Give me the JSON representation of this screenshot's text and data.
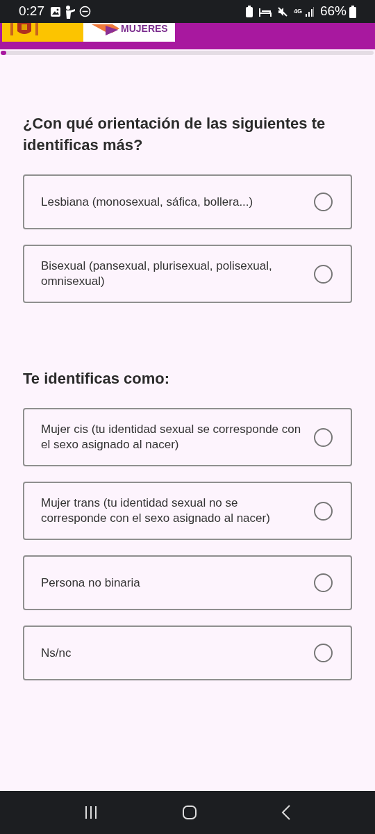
{
  "status_bar": {
    "time": "0:27",
    "network": "4G",
    "battery": "66%"
  },
  "header": {
    "logo_text": "MUJERES"
  },
  "progress": {
    "level": 0.015
  },
  "questions": [
    {
      "title": "¿Con qué orientación de las siguientes te identificas más?",
      "options": [
        {
          "label": "Lesbiana (monosexual, sáfica, bollera...)",
          "selected": false
        },
        {
          "label": "Bisexual (pansexual, plurisexual, polisexual, omnisexual)",
          "selected": false
        }
      ]
    },
    {
      "title": "Te identificas como:",
      "options": [
        {
          "label": "Mujer cis (tu identidad sexual se corresponde con el sexo asignado al nacer)",
          "selected": false
        },
        {
          "label": "Mujer trans (tu identidad sexual no se corresponde con el sexo asignado al nacer)",
          "selected": false
        },
        {
          "label": "Persona no binaria",
          "selected": false
        },
        {
          "label": "Ns/nc",
          "selected": false
        }
      ]
    }
  ]
}
